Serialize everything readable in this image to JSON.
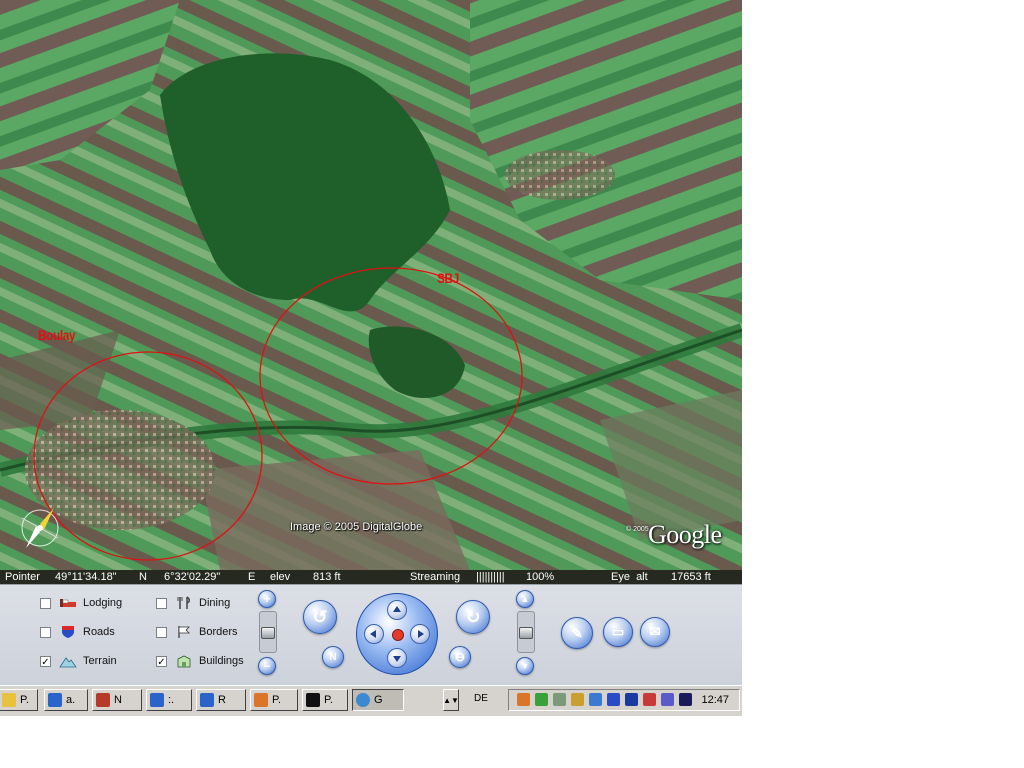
{
  "map": {
    "labels": [
      "SBJ",
      "Boulay"
    ],
    "imagery_credit": "Image © 2005 DigitalGlobe",
    "logo_copyright": "© 2005",
    "logo": "Google",
    "annotation_color": "#e01010"
  },
  "status": {
    "pointer_label": "Pointer",
    "lat": "49°11'34.18\"",
    "lat_dir": "N",
    "lon": "6°32'02.29\"",
    "lon_dir": "E",
    "elev_label": "elev",
    "elev_value": "813 ft",
    "streaming_label": "Streaming",
    "streaming_bar": "||||||||||",
    "streaming_percent": "100%",
    "eye_label": "Eye  alt",
    "eye_value": "17653 ft"
  },
  "layers": [
    {
      "label": "Lodging",
      "checked": false,
      "icon": "bed-icon"
    },
    {
      "label": "Dining",
      "checked": false,
      "icon": "fork-knife-icon"
    },
    {
      "label": "Roads",
      "checked": false,
      "icon": "road-shield-icon"
    },
    {
      "label": "Borders",
      "checked": false,
      "icon": "flag-icon"
    },
    {
      "label": "Terrain",
      "checked": true,
      "icon": "mountain-icon"
    },
    {
      "label": "Buildings",
      "checked": true,
      "icon": "building-icon"
    }
  ],
  "taskbar": {
    "tasks": [
      "P.",
      "a.",
      "N",
      ":.",
      "R",
      "P.",
      "P.",
      "G"
    ],
    "language": "DE",
    "clock": "12:47"
  }
}
